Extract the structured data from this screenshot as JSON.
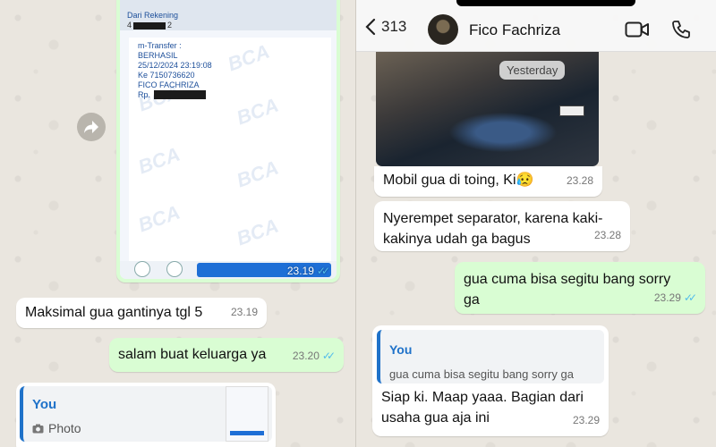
{
  "left": {
    "receipt": {
      "from_label": "Dari Rekening",
      "account": "4",
      "account_tail": "2",
      "lines": [
        "m-Transfer :",
        "BERHASIL",
        "25/12/2024 23:19:08",
        "Ke 7150736620",
        "FICO FACHRIZA",
        "Rp."
      ],
      "watermark": "BCA",
      "time": "23.19"
    },
    "messages": [
      {
        "text": "Maksimal gua gantinya tgl 5",
        "time": "23.19"
      },
      {
        "text": "salam buat keluarga ya",
        "time": "23.20"
      }
    ],
    "reply_card": {
      "name": "You",
      "text": "Photo"
    }
  },
  "right": {
    "header": {
      "back_count": "313",
      "contact_name": "Fico Fachriza"
    },
    "date_chip": "Yesterday",
    "messages": [
      {
        "text": "Mobil gua di toing, Ki😥",
        "time": "23.28"
      },
      {
        "line1": "Nyerempet separator, karena kaki-",
        "line2": "kakinya udah ga bagus",
        "time": "23.28"
      },
      {
        "line1": "gua cuma bisa segitu bang sorry",
        "line2": "ga",
        "time": "23.29"
      },
      {
        "quote_name": "You",
        "quote_text": "gua cuma bisa segitu bang sorry ga",
        "line1": "Siap ki. Maap yaaa. Bagian dari",
        "line2": "usaha gua aja ini",
        "time": "23.29"
      }
    ]
  },
  "colors": {
    "outgoing": "#d9fdd3",
    "incoming": "#ffffff",
    "read_ticks": "#53bdeb",
    "quote_accent": "#1f72c9"
  },
  "icons": [
    "forward-icon",
    "back-chevron-icon",
    "video-call-icon",
    "phone-icon",
    "camera-icon",
    "read-ticks-icon"
  ]
}
